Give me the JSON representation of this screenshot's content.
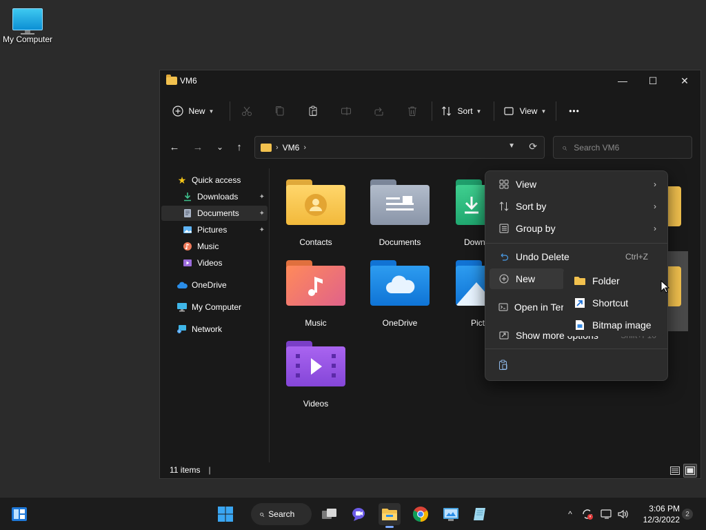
{
  "desktop": {
    "icons": [
      {
        "label": "My Computer",
        "icon": "computer-icon"
      }
    ]
  },
  "window": {
    "title": "VM6",
    "controls": {
      "minimize": "—",
      "maximize": "☐",
      "close": "✕"
    }
  },
  "toolbar": {
    "new_label": "New",
    "sort_label": "Sort",
    "view_label": "View",
    "more_label": "•••",
    "icons": [
      "cut-icon",
      "copy-icon",
      "paste-icon",
      "rename-icon",
      "share-icon",
      "delete-icon"
    ]
  },
  "nav": {
    "back": "←",
    "forward": "→",
    "recent": "⌄",
    "up": "↑"
  },
  "address": {
    "crumbs": [
      "VM6"
    ],
    "separator": "›"
  },
  "search": {
    "placeholder": "Search VM6"
  },
  "sidebar": {
    "items": [
      {
        "label": "Quick access",
        "icon": "star-icon",
        "color": "#f5c518"
      },
      {
        "label": "Downloads",
        "icon": "download-icon",
        "color": "#3fc18d",
        "pinned": true
      },
      {
        "label": "Documents",
        "icon": "document-icon",
        "color": "#a9b4c6",
        "pinned": true,
        "selected": true
      },
      {
        "label": "Pictures",
        "icon": "picture-icon",
        "color": "#5fb4f5",
        "pinned": true
      },
      {
        "label": "Music",
        "icon": "music-icon",
        "color": "#f07a5a"
      },
      {
        "label": "Videos",
        "icon": "video-icon",
        "color": "#9b6bdc"
      },
      {
        "label": "OneDrive",
        "icon": "cloud-icon",
        "color": "#2a8de8"
      },
      {
        "label": "My Computer",
        "icon": "computer-icon",
        "color": "#3fb6e8"
      },
      {
        "label": "Network",
        "icon": "network-icon",
        "color": "#3fb6e8"
      }
    ],
    "pin_glyph": "📌"
  },
  "files": [
    {
      "name": "Contacts",
      "icon": "contacts-folder-icon"
    },
    {
      "name": "Documents",
      "icon": "documents-folder-icon"
    },
    {
      "name": "Downl",
      "icon": "downloads-folder-icon"
    },
    {
      "name": "Music",
      "icon": "music-folder-icon"
    },
    {
      "name": "OneDrive",
      "icon": "onedrive-folder-icon"
    },
    {
      "name": "Pict",
      "icon": "pictures-folder-icon"
    },
    {
      "name": "Videos",
      "icon": "videos-folder-icon"
    }
  ],
  "status": {
    "count": "11 items",
    "caret": "|"
  },
  "context_menu": {
    "items": [
      {
        "label": "View",
        "icon": "grid-icon",
        "has_submenu": true
      },
      {
        "label": "Sort by",
        "icon": "sort-icon",
        "has_submenu": true
      },
      {
        "label": "Group by",
        "icon": "group-icon",
        "has_submenu": true
      },
      {
        "label": "Undo Delete",
        "icon": "undo-icon",
        "shortcut": "Ctrl+Z"
      },
      {
        "label": "New",
        "icon": "plus-circle-icon",
        "has_submenu": true,
        "hover": true
      },
      {
        "label": "Open in Ter",
        "icon": "terminal-icon"
      },
      {
        "label": "Show more options",
        "icon": "show-more-icon",
        "shortcut": "Shift+F10"
      }
    ],
    "bottom_icon": "paste-icon"
  },
  "new_submenu": {
    "items": [
      {
        "label": "Folder",
        "icon": "folder-icon"
      },
      {
        "label": "Shortcut",
        "icon": "shortcut-icon"
      },
      {
        "label": "Bitmap image",
        "icon": "bitmap-icon"
      }
    ]
  },
  "taskbar": {
    "search_label": "Search",
    "clock_time": "3:06 PM",
    "clock_date": "12/3/2022",
    "notifications": "2"
  },
  "colors": {
    "window_bg": "#191919",
    "menu_bg": "#2c2c2c",
    "folder_yellow": "#f2c14e",
    "accent": "#7aa7ff"
  }
}
